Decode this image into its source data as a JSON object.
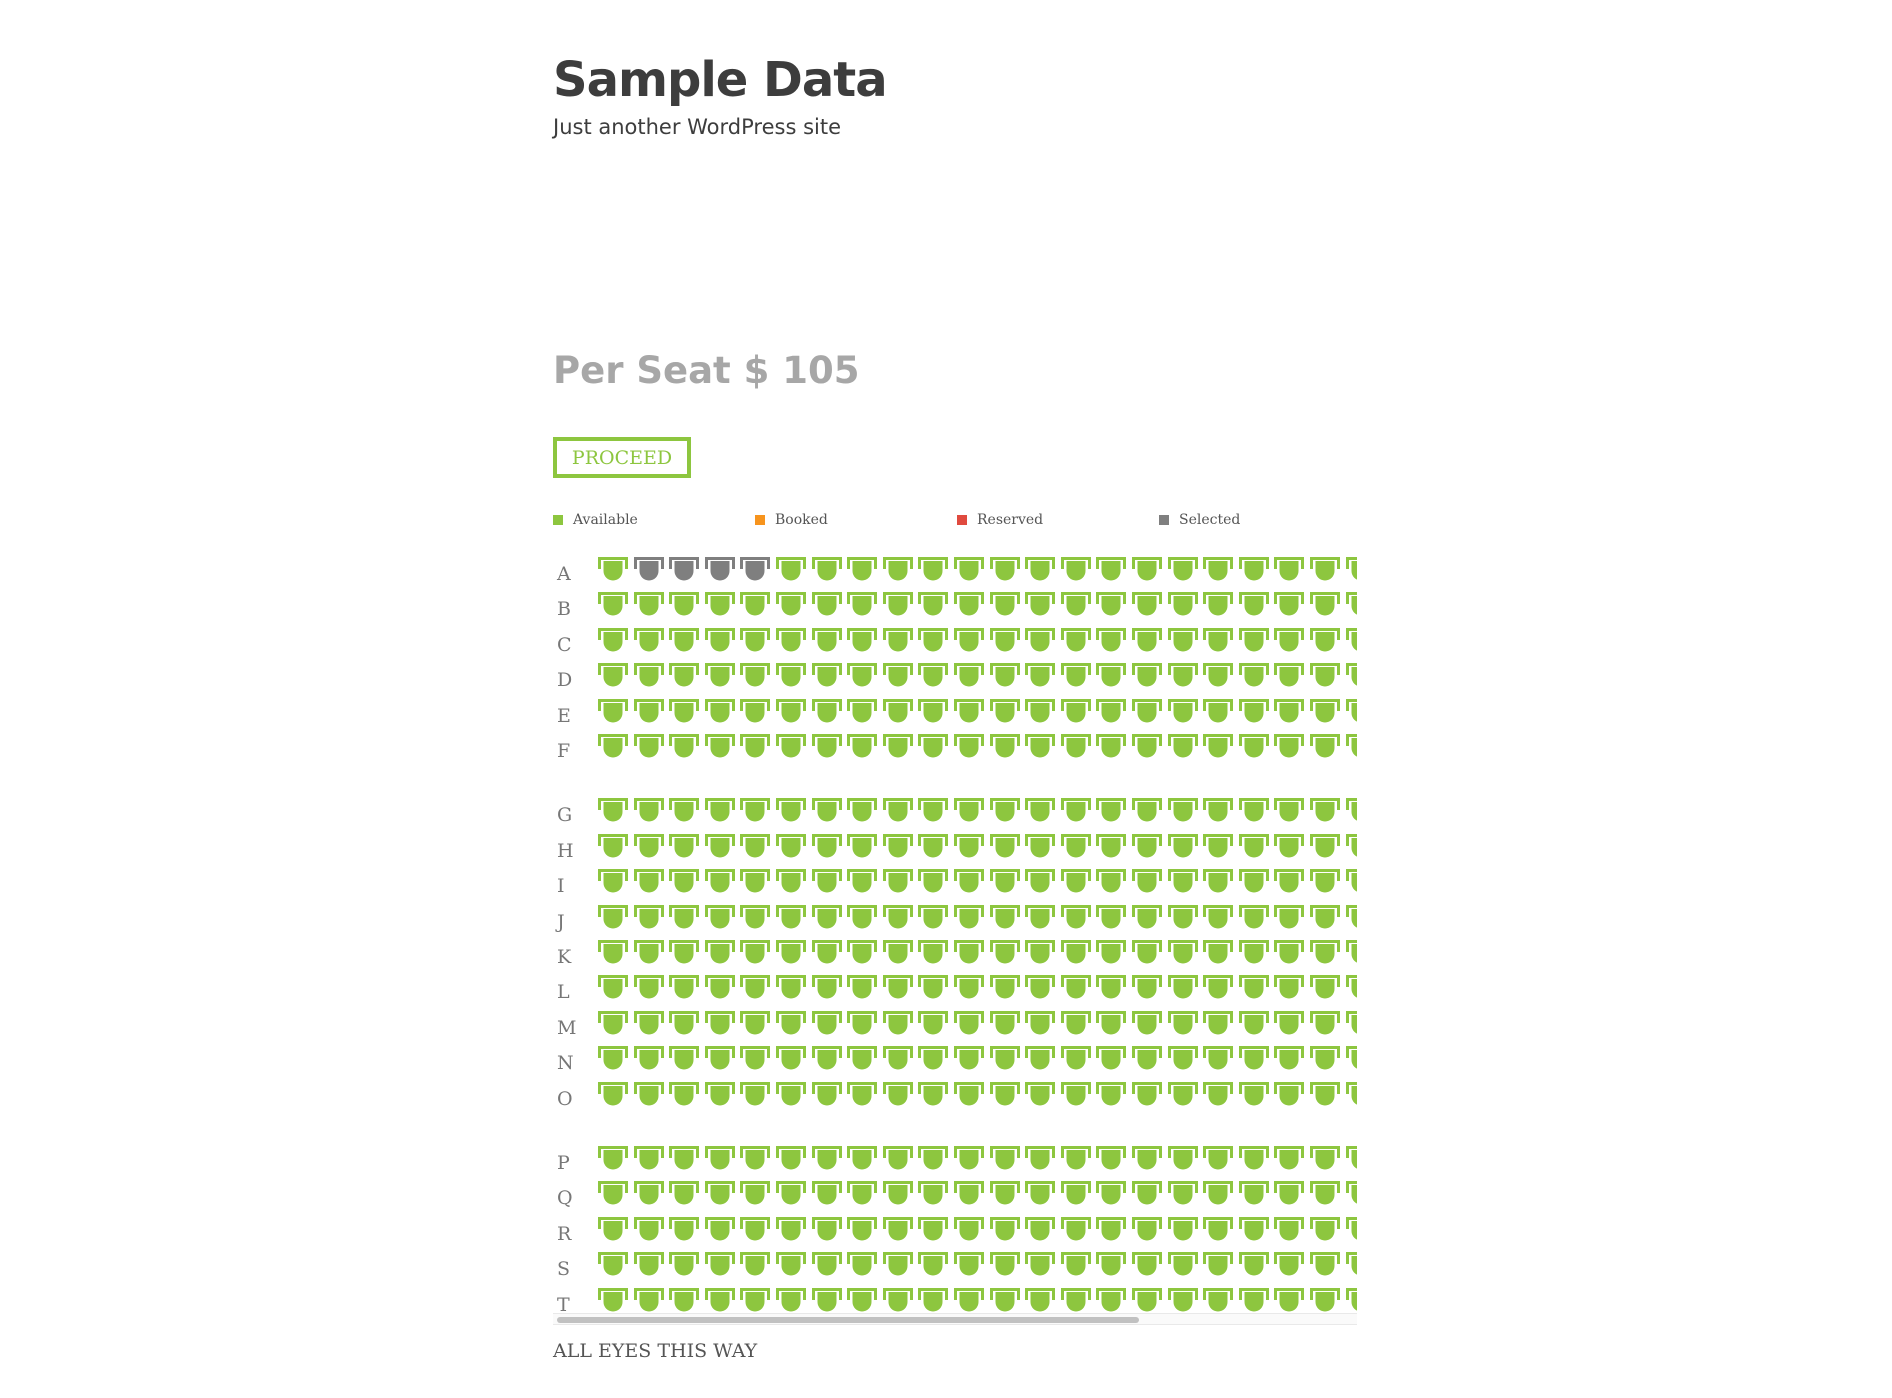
{
  "site": {
    "title": "Sample Data",
    "description": "Just another WordPress site"
  },
  "price_label": "Per Seat $ 105",
  "proceed_label": "PROCEED",
  "legend": [
    {
      "label": "Available",
      "color": "#8dc63f"
    },
    {
      "label": "Booked",
      "color": "#f7941d"
    },
    {
      "label": "Reserved",
      "color": "#e04a3f"
    },
    {
      "label": "Selected",
      "color": "#7f7f7f"
    }
  ],
  "colors": {
    "available": "#8dc63f",
    "selected": "#7f7f7f",
    "accent": "#8dc63f"
  },
  "seat_sections": [
    {
      "rows": [
        "A",
        "B",
        "C",
        "D",
        "E",
        "F"
      ]
    },
    {
      "rows": [
        "G",
        "H",
        "I",
        "J",
        "K",
        "L",
        "M",
        "N",
        "O"
      ]
    },
    {
      "rows": [
        "P",
        "Q",
        "R",
        "S",
        "T"
      ]
    }
  ],
  "seats_per_row": 22,
  "seat_status": {
    "A": [
      "available",
      "selected",
      "selected",
      "selected",
      "selected",
      "available",
      "available",
      "available",
      "available",
      "available",
      "available",
      "available",
      "available",
      "available",
      "available",
      "available",
      "available",
      "available",
      "available",
      "available",
      "available",
      "available"
    ]
  },
  "screen_label": "ALL EYES THIS WAY"
}
